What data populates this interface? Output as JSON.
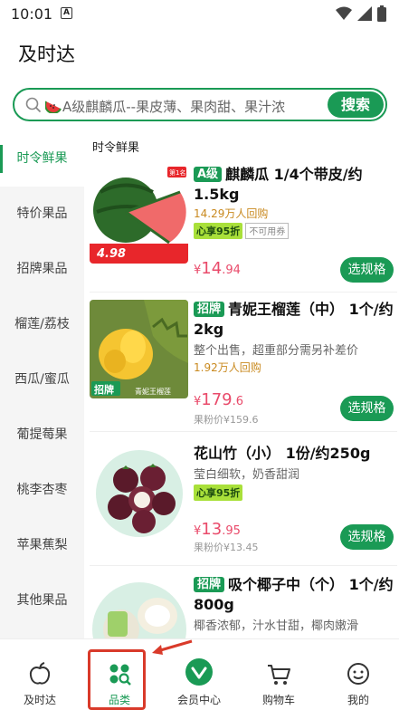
{
  "status_bar": {
    "time": "10:01",
    "notif_letter": "A"
  },
  "app": {
    "title": "及时达"
  },
  "search": {
    "placeholder": "A级麒麟瓜--果皮薄、果肉甜、果汁浓",
    "button_label": "搜索"
  },
  "sidebar": {
    "items": [
      {
        "label": "时令鲜果",
        "active": true
      },
      {
        "label": "特价果品"
      },
      {
        "label": "招牌果品"
      },
      {
        "label": "榴莲/荔枝"
      },
      {
        "label": "西瓜/蜜瓜"
      },
      {
        "label": "葡提莓果"
      },
      {
        "label": "桃李杏枣"
      },
      {
        "label": "苹果蕉梨"
      },
      {
        "label": "其他果品"
      }
    ]
  },
  "section": {
    "title": "时令鲜果"
  },
  "products": [
    {
      "tag": "A级",
      "name": "麒麟瓜 1/4个带皮/约1.5kg",
      "sold": "14.29万人回购",
      "badge_member": "心享95折",
      "badge_coupon": "不可用券",
      "price_yen": "¥",
      "price_int": "14",
      "price_dec": ".94",
      "button": "选规格",
      "img_price": "4.98",
      "img_rank": "第1名"
    },
    {
      "tag": "招牌",
      "name": "青妮王榴莲（中） 1个/约2kg",
      "desc": "整个出售，超重部分需另补差价",
      "sold": "1.92万人回购",
      "price_yen": "¥",
      "price_int": "179",
      "price_dec": ".6",
      "orig_price": "果粉价¥159.6",
      "button": "选规格",
      "img_brand": "招牌",
      "img_label": "青妮王榴莲"
    },
    {
      "name": "花山竹（小） 1份/约250g",
      "desc": "莹白细软，奶香甜润",
      "badge_member": "心享95折",
      "price_yen": "¥",
      "price_int": "13",
      "price_dec": ".95",
      "orig_price": "果粉价¥13.45",
      "button": "选规格"
    },
    {
      "tag": "招牌",
      "name": "吸个椰子中（个） 1个/约800g",
      "desc": "椰香浓郁，汁水甘甜，椰肉嫩滑"
    }
  ],
  "bottom_nav": {
    "items": [
      {
        "label": "及时达",
        "icon": "apple-icon"
      },
      {
        "label": "品类",
        "icon": "category-icon",
        "active": true
      },
      {
        "label": "会员中心",
        "icon": "member-icon"
      },
      {
        "label": "购物车",
        "icon": "cart-icon"
      },
      {
        "label": "我的",
        "icon": "profile-icon"
      }
    ]
  },
  "colors": {
    "brand_green": "#1a9a55",
    "price_pink": "#e94a6a",
    "annotation_red": "#d93a2a"
  }
}
